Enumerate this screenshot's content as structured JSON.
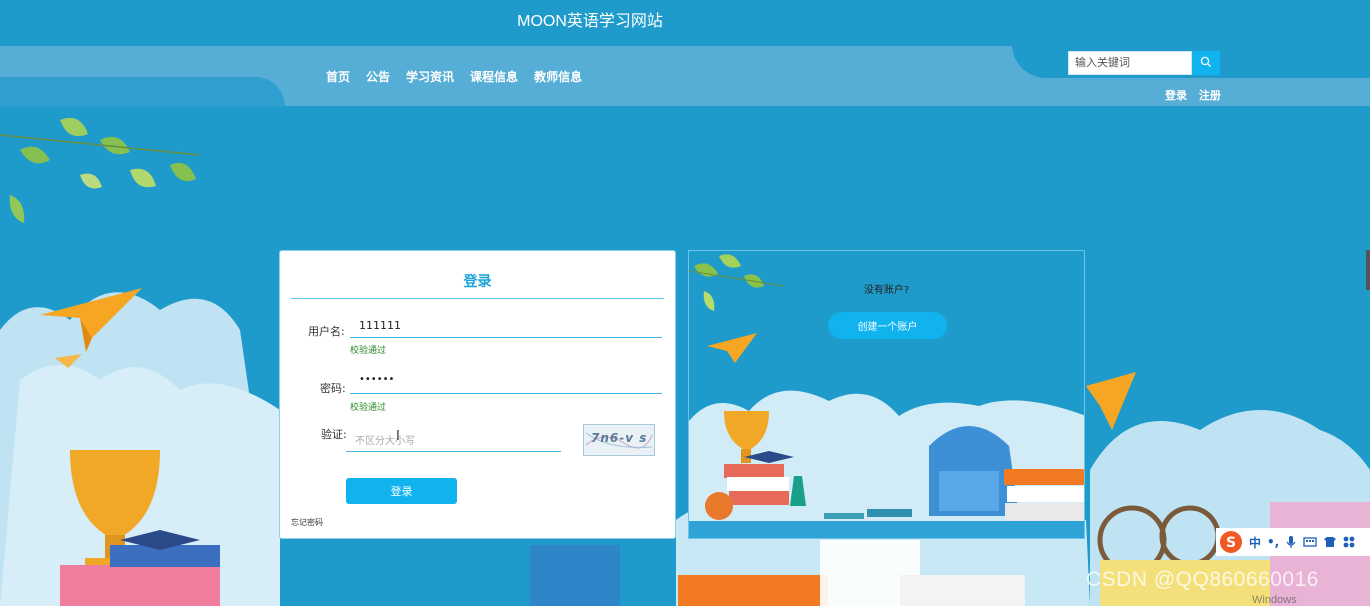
{
  "header": {
    "site_title": "MOON英语学习网站",
    "search_placeholder": "输入关键词",
    "search_icon": "search-icon",
    "login_link": "登录",
    "register_link": "注册"
  },
  "nav": {
    "items": [
      {
        "label": "首页"
      },
      {
        "label": "公告"
      },
      {
        "label": "学习资讯"
      },
      {
        "label": "课程信息"
      },
      {
        "label": "教师信息"
      }
    ]
  },
  "login_form": {
    "title": "登录",
    "username_label": "用户名:",
    "username_value": "111111",
    "username_status": "校验通过",
    "password_label": "密码:",
    "password_value": "••••••",
    "password_status": "校验通过",
    "captcha_label": "验证:",
    "captcha_placeholder": "不区分大小写",
    "captcha_text": "7n6-v s",
    "submit_label": "登录",
    "forgot_link": "忘记密码"
  },
  "register_panel": {
    "question": "没有账户?",
    "create_label": "创建一个账户"
  },
  "overlay": {
    "ime_char": "中",
    "ime_punct": "•,",
    "watermark": "CSDN @QQ860660016",
    "os_text": "Windows"
  },
  "colors": {
    "primary_bg": "#1f9bcb",
    "accent": "#11b3ef",
    "nav_band": "#56aed6",
    "status_ok": "#2a8a2a"
  }
}
